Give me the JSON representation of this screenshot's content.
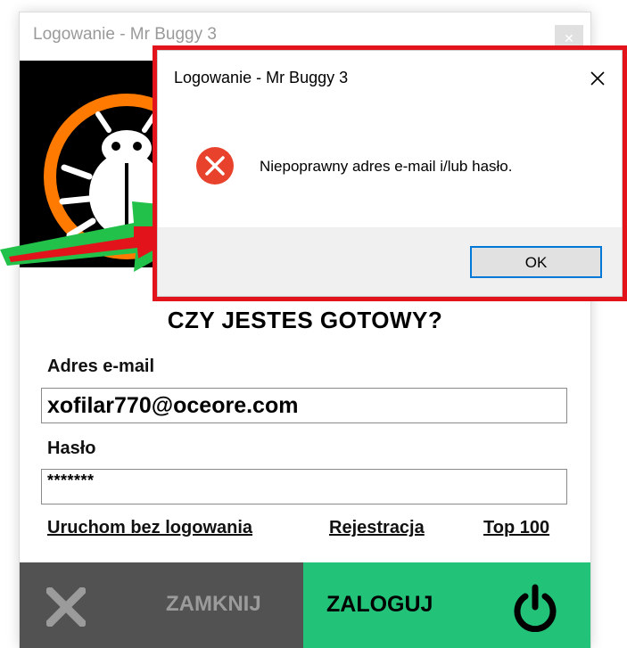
{
  "login_window": {
    "title": "Logowanie - Mr Buggy 3",
    "heading": "CZY JESTES GOTOWY?",
    "email_label": "Adres e-mail",
    "email_value": "xofilar770@oceore.com",
    "password_label": "Hasło",
    "password_value": "*******",
    "links": {
      "guest": "Uruchom bez logowania",
      "register": "Rejestracja",
      "top100": "Top 100"
    },
    "close_button_label": "ZAMKNIJ",
    "login_button_label": "ZALOGUJ",
    "icons": {
      "close": "x-icon",
      "login": "power-icon",
      "logo": "bug-logo-icon"
    }
  },
  "dialog": {
    "title": "Logowanie - Mr Buggy 3",
    "message": "Niepoprawny adres e-mail i/lub hasło.",
    "ok_label": "OK",
    "icon": "error-icon"
  },
  "colors": {
    "highlight": "#e3131b",
    "arrow_green": "#22c24a",
    "arrow_red": "#e3131b",
    "login_button": "#22c279",
    "close_button": "#525252",
    "logo_orange": "#ff7a00",
    "error_red": "#e8412c",
    "ok_border": "#0078d7"
  }
}
